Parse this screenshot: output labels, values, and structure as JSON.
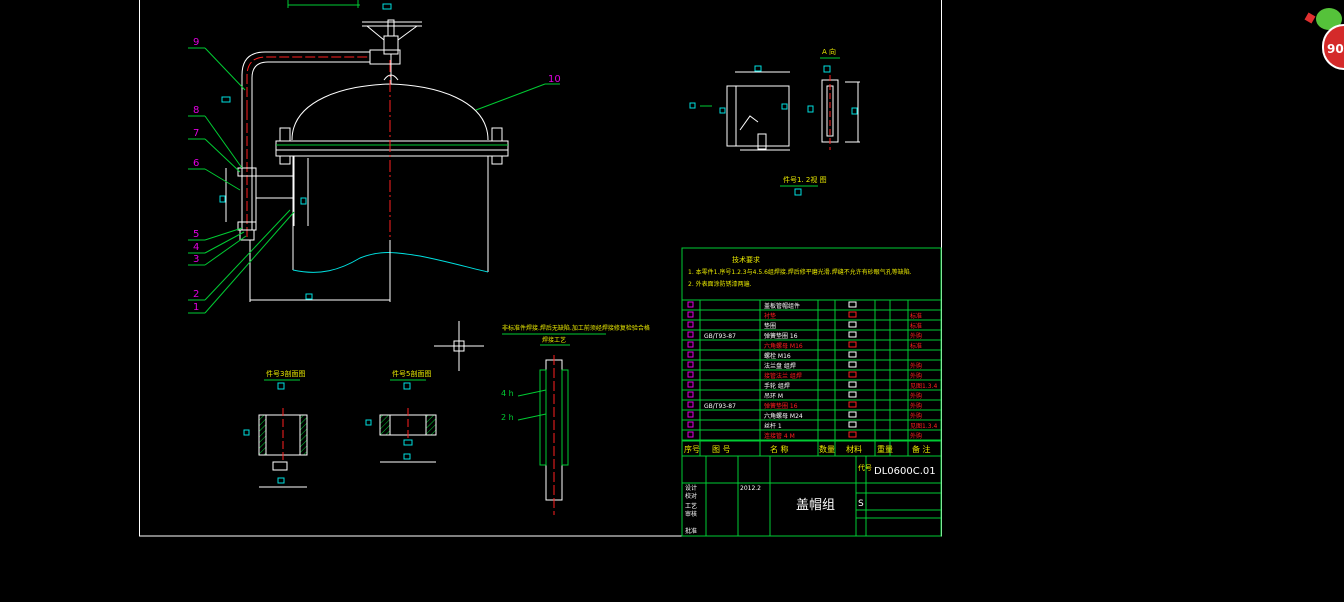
{
  "drawing": {
    "code": "DL0600C.01",
    "name": "盖帽组",
    "scale_left": "S",
    "notes_title": "技术要求",
    "note1": "1. 本零件1.序号1.2.3与4.5.6组焊接.焊后修平磨光滑.焊缝不允许有砂眼气孔等缺陷.",
    "note2": "2. 外表面涂防锈漆两遍.",
    "view_a": "A 向",
    "view_b": "件号1. 2视 图",
    "sec1": "件号3剖面图",
    "sec2": "件号5剖面图",
    "weld_note": "非标准件焊接.焊后无缺陷.加工前须经焊接修复检验合格",
    "weld_sub": "焊接工艺",
    "weld_a": "4 h",
    "weld_b": "2 h",
    "header_seq": "序号",
    "header_code": "图 号",
    "header_name": "名 称",
    "header_qty": "数量",
    "header_mat": "材料",
    "header_weight": "重量",
    "header_remark": "备 注",
    "code_label": "代号",
    "date_text": "2012.2",
    "row_labels": [
      "设计",
      "校对",
      "工艺",
      "审核",
      "批准"
    ]
  },
  "part_numbers": [
    "9",
    "8",
    "7",
    "6",
    "5",
    "4",
    "3",
    "2",
    "1",
    "10"
  ],
  "bom_rows": [
    {
      "code": "",
      "name": "盖板管帽组件",
      "remark": ""
    },
    {
      "code": "",
      "name": "衬垫",
      "remark": "标准"
    },
    {
      "code": "",
      "name": "垫圈",
      "remark": "标准"
    },
    {
      "code": "GB/T93-87",
      "name": "弹簧垫圈 16",
      "remark": "外购"
    },
    {
      "code": "",
      "name": "六角螺母 M16",
      "remark": "标准"
    },
    {
      "code": "",
      "name": "螺栓 M16",
      "remark": ""
    },
    {
      "code": "",
      "name": "法兰盘 组焊",
      "remark": "外购"
    },
    {
      "code": "",
      "name": "接管法兰 组焊",
      "remark": "外购"
    },
    {
      "code": "",
      "name": "手轮 组焊",
      "remark": "见图1.3.4"
    },
    {
      "code": "",
      "name": "吊环 M",
      "remark": "外购"
    },
    {
      "code": "GB/T93-87",
      "name": "弹簧垫圈 16",
      "remark": "外购"
    },
    {
      "code": "",
      "name": "六角螺母 M24",
      "remark": "外购"
    },
    {
      "code": "",
      "name": "丝杆 1",
      "remark": "见图1.3.4"
    },
    {
      "code": "",
      "name": "连接管 4 M",
      "remark": "外购"
    }
  ],
  "badge": "90",
  "colors": {
    "green": "#00cc33",
    "cyan": "#00e0e0",
    "magenta": "#e000e0",
    "red": "#ff2020",
    "white": "#ffffff",
    "yellow": "#e8e800"
  }
}
